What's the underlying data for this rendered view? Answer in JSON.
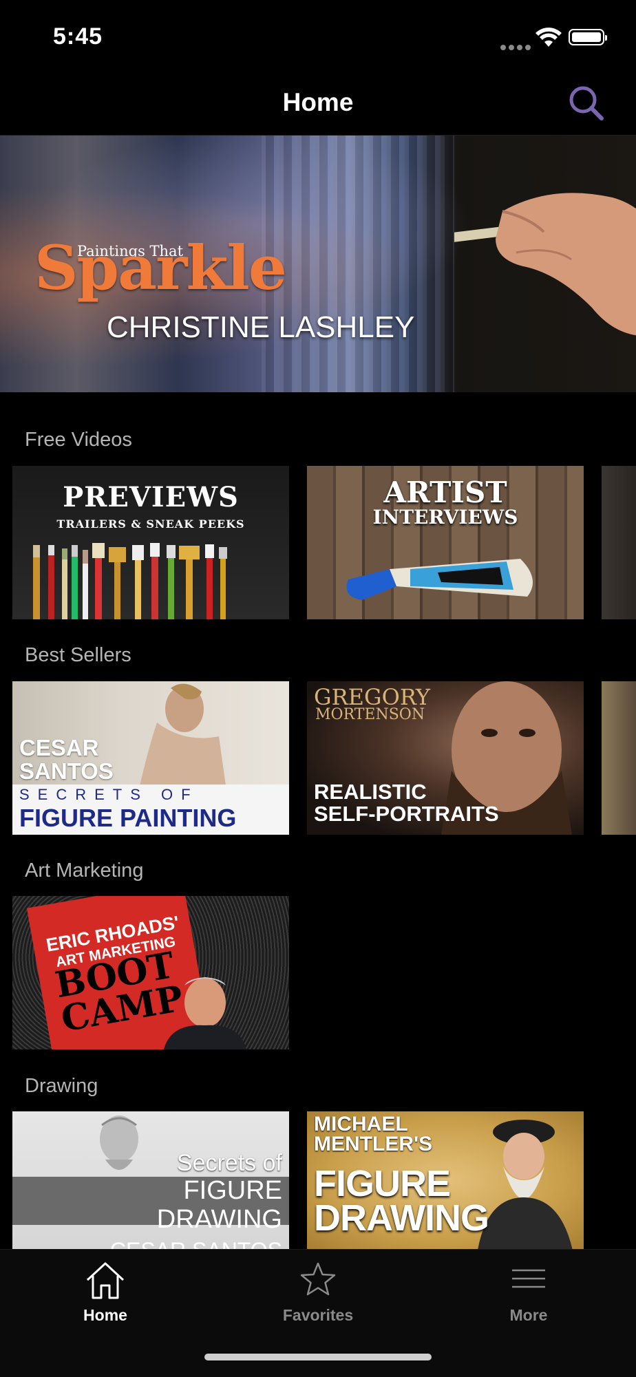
{
  "status_bar": {
    "time": "5:45"
  },
  "nav": {
    "title": "Home"
  },
  "hero": {
    "small_title": "Paintings That",
    "big_title": "Sparkle",
    "artist": "CHRISTINE LASHLEY"
  },
  "sections": {
    "free_videos": {
      "title": "Free Videos",
      "cards": [
        {
          "line1": "PREVIEWS",
          "line2": "TRAILERS & SNEAK PEEKS"
        },
        {
          "line1": "ARTIST",
          "line2": "INTERVIEWS"
        }
      ]
    },
    "best_sellers": {
      "title": "Best Sellers",
      "cards": [
        {
          "name": "CESAR\nSANTOS",
          "sub1": "SECRETS OF",
          "sub2": "FIGURE PAINTING"
        },
        {
          "name1": "GREGORY",
          "name2": "MORTENSON",
          "title": "REALISTIC\nSELF-PORTRAITS"
        }
      ]
    },
    "art_marketing": {
      "title": "Art Marketing",
      "cards": [
        {
          "line1": "ERIC RHOADS'",
          "line2": "ART MARKETING",
          "line3": "BOOT\nCAMP"
        }
      ]
    },
    "drawing": {
      "title": "Drawing",
      "cards": [
        {
          "l1": "Secrets of",
          "l2": "FIGURE",
          "l3": "DRAWING",
          "l4": "CESAR SANTOS"
        },
        {
          "name": "MICHAEL\nMENTLER'S",
          "title": "FIGURE\nDRAWING"
        }
      ]
    }
  },
  "tab_bar": {
    "tabs": [
      {
        "label": "Home",
        "icon": "home-icon",
        "active": true
      },
      {
        "label": "Favorites",
        "icon": "star-icon",
        "active": false
      },
      {
        "label": "More",
        "icon": "menu-icon",
        "active": false
      }
    ]
  },
  "colors": {
    "accent_orange": "#f07a3a",
    "search_purple": "#7b64b0",
    "inactive_tab": "#8a8a8a",
    "section_title": "#b5b5b5"
  }
}
